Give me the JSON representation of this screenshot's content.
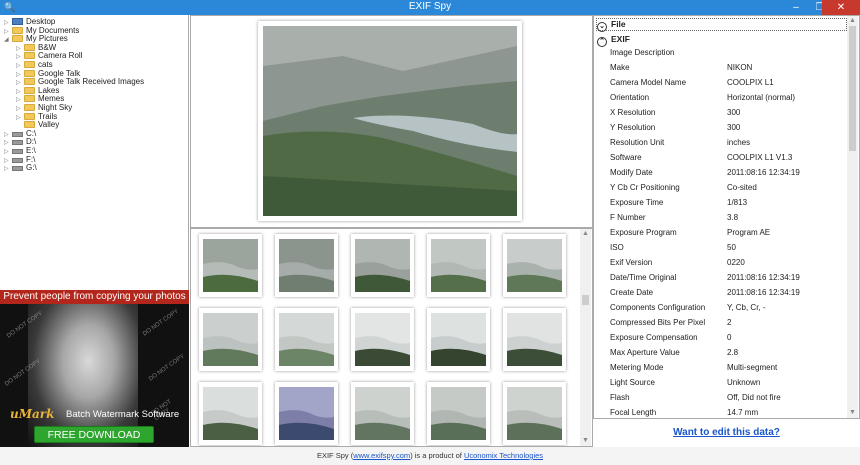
{
  "window": {
    "title": "EXIF Spy",
    "minimize": "–",
    "maximize": "❐",
    "close": "✕"
  },
  "tree": {
    "items": [
      {
        "label": "Desktop",
        "icon": "pc",
        "level": 0,
        "toggle": "▷"
      },
      {
        "label": "My Documents",
        "icon": "folder",
        "level": 0,
        "toggle": "▷"
      },
      {
        "label": "My Pictures",
        "icon": "folder",
        "level": 0,
        "toggle": "◢"
      },
      {
        "label": "B&W",
        "icon": "folder",
        "level": 1,
        "toggle": "▷"
      },
      {
        "label": "Camera Roll",
        "icon": "folder",
        "level": 1,
        "toggle": "▷"
      },
      {
        "label": "cats",
        "icon": "folder",
        "level": 1,
        "toggle": "▷"
      },
      {
        "label": "Google Talk",
        "icon": "folder",
        "level": 1,
        "toggle": "▷"
      },
      {
        "label": "Google Talk Received Images",
        "icon": "folder",
        "level": 1,
        "toggle": "▷"
      },
      {
        "label": "Lakes",
        "icon": "folder",
        "level": 1,
        "toggle": "▷"
      },
      {
        "label": "Memes",
        "icon": "folder",
        "level": 1,
        "toggle": "▷"
      },
      {
        "label": "Night Sky",
        "icon": "folder",
        "level": 1,
        "toggle": "▷"
      },
      {
        "label": "Trails",
        "icon": "folder",
        "level": 1,
        "toggle": "▷"
      },
      {
        "label": "Valley",
        "icon": "folder",
        "level": 1,
        "toggle": ""
      },
      {
        "label": "C:\\",
        "icon": "drive",
        "level": 0,
        "toggle": "▷"
      },
      {
        "label": "D:\\",
        "icon": "drive",
        "level": 0,
        "toggle": "▷"
      },
      {
        "label": "E:\\",
        "icon": "drive",
        "level": 0,
        "toggle": "▷"
      },
      {
        "label": "F:\\",
        "icon": "drive",
        "level": 0,
        "toggle": "▷"
      },
      {
        "label": "G:\\",
        "icon": "drive",
        "level": 0,
        "toggle": "▷"
      }
    ]
  },
  "ad": {
    "headline": "Prevent people from copying your photos",
    "brand": "uMark",
    "tagline": "Batch Watermark Software",
    "button": "FREE DOWNLOAD",
    "watermark": "DO NOT COPY"
  },
  "thumbnails": {
    "count": 15
  },
  "exif": {
    "file_section": "File",
    "exif_section": "EXIF",
    "rows": [
      {
        "key": "Image Description",
        "value": ""
      },
      {
        "key": "Make",
        "value": "NIKON"
      },
      {
        "key": "Camera Model Name",
        "value": "COOLPIX L1"
      },
      {
        "key": "Orientation",
        "value": "Horizontal (normal)"
      },
      {
        "key": "X Resolution",
        "value": "300"
      },
      {
        "key": "Y Resolution",
        "value": "300"
      },
      {
        "key": "Resolution Unit",
        "value": "inches"
      },
      {
        "key": "Software",
        "value": "COOLPIX L1  V1.3"
      },
      {
        "key": "Modify Date",
        "value": "2011:08:16 12:34:19"
      },
      {
        "key": "Y Cb Cr Positioning",
        "value": "Co-sited"
      },
      {
        "key": "Exposure Time",
        "value": "1/813"
      },
      {
        "key": "F Number",
        "value": "3.8"
      },
      {
        "key": "Exposure Program",
        "value": "Program AE"
      },
      {
        "key": "ISO",
        "value": "50"
      },
      {
        "key": "Exif Version",
        "value": "0220"
      },
      {
        "key": "Date/Time Original",
        "value": "2011:08:16 12:34:19"
      },
      {
        "key": "Create Date",
        "value": "2011:08:16 12:34:19"
      },
      {
        "key": "Components Configuration",
        "value": "Y, Cb, Cr, -"
      },
      {
        "key": "Compressed Bits Per Pixel",
        "value": "2"
      },
      {
        "key": "Exposure Compensation",
        "value": "0"
      },
      {
        "key": "Max Aperture Value",
        "value": "2.8"
      },
      {
        "key": "Metering Mode",
        "value": "Multi-segment"
      },
      {
        "key": "Light Source",
        "value": "Unknown"
      },
      {
        "key": "Flash",
        "value": "Off, Did not fire"
      },
      {
        "key": "Focal Length",
        "value": "14.7 mm"
      }
    ]
  },
  "edit_link": "Want to edit this data?",
  "footer": {
    "prefix": "EXIF Spy (",
    "site": "www.exifspy.com",
    "middle": ") is a product of ",
    "company": "Uconomix Technologies"
  },
  "colors": {
    "titlebar": "#2b88d9",
    "close": "#c7382d",
    "ad_head": "#b3261b",
    "download": "#2ea52e",
    "link": "#1a56c9"
  }
}
